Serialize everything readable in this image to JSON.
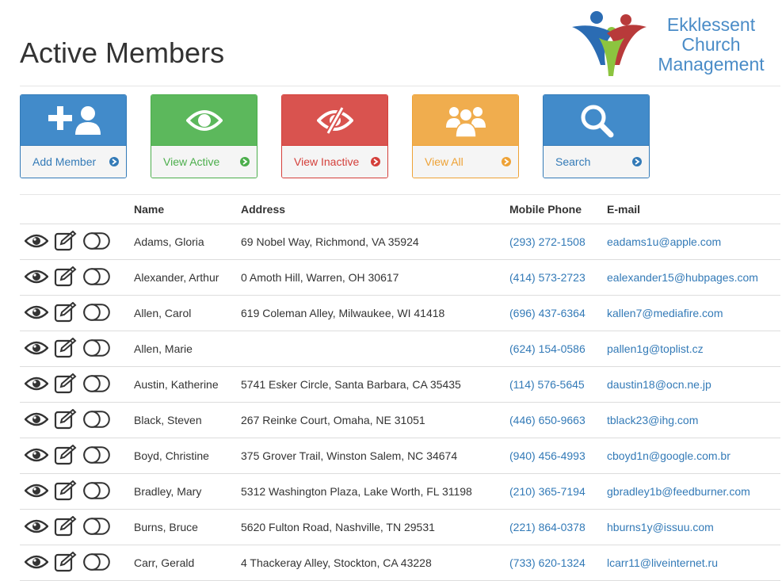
{
  "page": {
    "title": "Active Members"
  },
  "logo": {
    "line1": "Ekklessent",
    "line2": "Church",
    "line3": "Management"
  },
  "actions": [
    {
      "label": "Add Member",
      "icon": "add-user-icon",
      "color": "#428bca"
    },
    {
      "label": "View Active",
      "icon": "eye-icon",
      "color": "#5cb85c"
    },
    {
      "label": "View Inactive",
      "icon": "eye-slash-icon",
      "color": "#d9534f"
    },
    {
      "label": "View All",
      "icon": "users-icon",
      "color": "#f0ad4e"
    },
    {
      "label": "Search",
      "icon": "search-icon",
      "color": "#428bca"
    }
  ],
  "table": {
    "columns": [
      "Name",
      "Address",
      "Mobile Phone",
      "E-mail"
    ],
    "row_icons": [
      "eye-icon",
      "edit-icon",
      "toggle-icon"
    ],
    "rows": [
      {
        "name": "Adams, Gloria",
        "address": "69 Nobel Way, Richmond, VA 35924",
        "phone": "(293) 272-1508",
        "email": "eadams1u@apple.com"
      },
      {
        "name": "Alexander, Arthur",
        "address": "0 Amoth Hill, Warren, OH 30617",
        "phone": "(414) 573-2723",
        "email": "ealexander15@hubpages.com"
      },
      {
        "name": "Allen, Carol",
        "address": "619 Coleman Alley, Milwaukee, WI 41418",
        "phone": "(696) 437-6364",
        "email": "kallen7@mediafire.com"
      },
      {
        "name": "Allen, Marie",
        "address": "",
        "phone": "(624) 154-0586",
        "email": "pallen1g@toplist.cz"
      },
      {
        "name": "Austin, Katherine",
        "address": "5741 Esker Circle, Santa Barbara, CA 35435",
        "phone": "(114) 576-5645",
        "email": "daustin18@ocn.ne.jp"
      },
      {
        "name": "Black, Steven",
        "address": "267 Reinke Court, Omaha, NE 31051",
        "phone": "(446) 650-9663",
        "email": "tblack23@ihg.com"
      },
      {
        "name": "Boyd, Christine",
        "address": "375 Grover Trail, Winston Salem, NC 34674",
        "phone": "(940) 456-4993",
        "email": "cboyd1n@google.com.br"
      },
      {
        "name": "Bradley, Mary",
        "address": "5312 Washington Plaza, Lake Worth, FL 31198",
        "phone": "(210) 365-7194",
        "email": "gbradley1b@feedburner.com"
      },
      {
        "name": "Burns, Bruce",
        "address": "5620 Fulton Road, Nashville, TN 29531",
        "phone": "(221) 864-0378",
        "email": "hburns1y@issuu.com"
      },
      {
        "name": "Carr, Gerald",
        "address": "4 Thackeray Alley, Stockton, CA 43228",
        "phone": "(733) 620-1324",
        "email": "lcarr11@liveinternet.ru"
      }
    ]
  }
}
